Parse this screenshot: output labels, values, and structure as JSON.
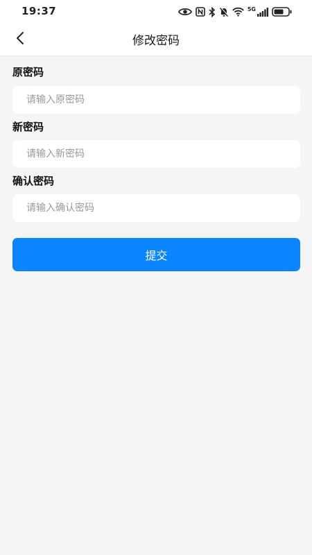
{
  "status_bar": {
    "time": "19:37",
    "network_label": "5G",
    "icons": [
      "eye-icon",
      "nfc-icon",
      "bluetooth-icon",
      "mute-bell-icon",
      "wifi-icon",
      "signal-icon",
      "battery-icon"
    ]
  },
  "header": {
    "back_icon": "chevron-left-icon",
    "title": "修改密码"
  },
  "form": {
    "fields": [
      {
        "label": "原密码",
        "placeholder": "请输入原密码",
        "value": ""
      },
      {
        "label": "新密码",
        "placeholder": "请输入新密码",
        "value": ""
      },
      {
        "label": "确认密码",
        "placeholder": "请输入确认密码",
        "value": ""
      }
    ],
    "submit_label": "提交"
  },
  "colors": {
    "accent": "#0a84ff",
    "background": "#f5f5f5",
    "card": "#ffffff"
  }
}
